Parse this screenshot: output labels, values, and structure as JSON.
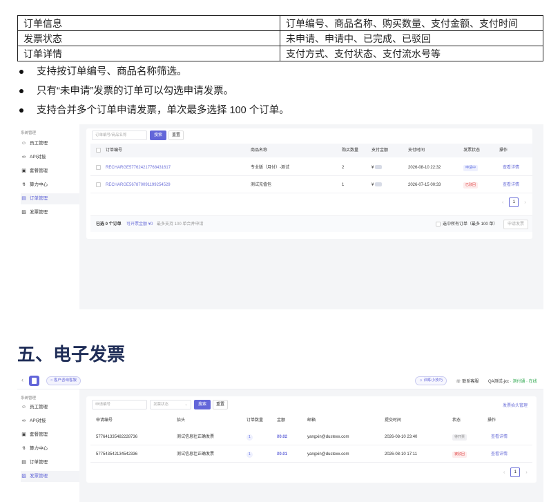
{
  "table": [
    [
      "订单信息",
      "订单编号、商品名称、购买数量、支付金额、支付时间"
    ],
    [
      "发票状态",
      "未申请、申请中、已完成、已驳回"
    ],
    [
      "订单详情",
      "支付方式、支付状态、支付流水号等"
    ]
  ],
  "bullets": [
    "支持按订单编号、商品名称筛选。",
    "只有“未申请”发票的订单可以勾选申请发票。",
    "支持合并多个订单申请发票，单次最多选择 100 个订单。"
  ],
  "sidebar": {
    "group": "系统管理",
    "items": [
      "员工管理",
      "API对接",
      "套餐管理",
      "算力中心",
      "订单管理",
      "发票管理"
    ],
    "icons": [
      "user-icon",
      "link-icon",
      "package-icon",
      "bolt-icon",
      "order-icon",
      "invoice-icon"
    ]
  },
  "shot1": {
    "search_placeholder": "订单编号/商品名称",
    "search_btn": "搜索",
    "reset_btn": "重置",
    "headers": [
      "订单编号",
      "商品名称",
      "购买数量",
      "支付金额",
      "支付时间",
      "发票状态",
      "操作"
    ],
    "rows": [
      {
        "id": "RECHARGE57762421776843161​7",
        "product": "专业版（月付）-测试",
        "qty": "2",
        "amount": "¥",
        "time": "2026-08-10 22:32",
        "status": "申请中",
        "action": "查看详情"
      },
      {
        "id": "RECHARGE567870091199254529",
        "product": "测试充值包",
        "qty": "1",
        "amount": "¥",
        "time": "2026-07-15 00:33",
        "status": "已驳回",
        "action": "查看详情"
      }
    ],
    "page": "1",
    "summary_selected": "已选 0 个订单",
    "summary_amount": "可开票金额 ¥0",
    "summary_hint": "最多支持 100 单合并申请",
    "select_all": "选中所有订单（最多 100 单）",
    "apply_btn": "申请发票"
  },
  "heading": "五、电子发票",
  "shot2": {
    "top_badge": "客户咨询客服",
    "guide": "训练小技巧",
    "support": "联系客服",
    "user": "QA测试-jxc",
    "user_tail": "· 测付通 · 在线",
    "input1": "申请编号",
    "input2": "发票状态",
    "search_btn": "搜索",
    "reset_btn": "重置",
    "header_link": "发票抬头管理",
    "headers": [
      "申请编号",
      "抬头",
      "订单数量",
      "金额",
      "邮箱",
      "提交时间",
      "状态",
      "操作"
    ],
    "rows": [
      {
        "id": "577641335482228736",
        "title": "测试信息壮正确发票",
        "count": "1",
        "amount": "¥0.02",
        "email": "yangxin@dustexx.com",
        "time": "2026-08-10 23:40",
        "status": "待开票",
        "action": "查看详情"
      },
      {
        "id": "577543542134542336",
        "title": "测试信息壮正确发票",
        "count": "1",
        "amount": "¥0.01",
        "email": "yangxin@dustexx.com",
        "time": "2026-08-10 17:11",
        "status": "被驳回",
        "action": "查看详情"
      }
    ],
    "page": "1"
  },
  "colors": {
    "accent": "#6366d9",
    "heading": "#1f2d57"
  }
}
